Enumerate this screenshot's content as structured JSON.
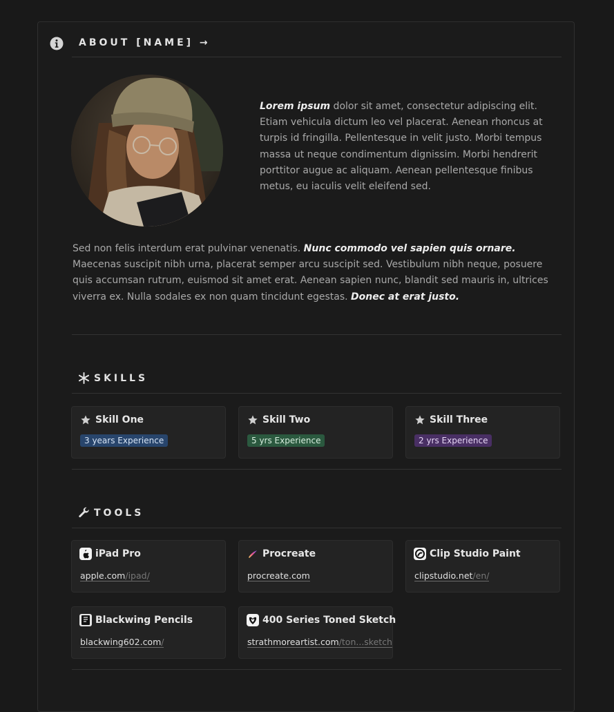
{
  "header": {
    "title": "ABOUT [NAME] →"
  },
  "about": {
    "intro_bold": "Lorem ipsum",
    "intro_text": " dolor sit amet, consectetur adipiscing elit. Etiam vehicula dictum leo vel placerat. Aenean rhoncus at turpis id fringilla. Pellentesque in velit justo. Morbi tempus massa ut neque condimentum dignissim. Morbi hendrerit porttitor augue ac aliquam. Aenean pellentesque finibus metus, eu iaculis velit eleifend sed.",
    "para_a": "Sed non felis interdum erat pulvinar venenatis. ",
    "para_b": "Nunc commodo vel sapien quis ornare.",
    "para_c": " Maecenas suscipit nibh urna, placerat semper arcu suscipit sed. Vestibulum nibh neque, posuere quis accumsan rutrum, euismod sit amet erat. Aenean sapien nunc, blandit sed mauris in, ultrices viverra ex. Nulla sodales ex non quam tincidunt egestas. ",
    "para_d": "Donec at erat justo."
  },
  "skills": {
    "heading": "SKILLS",
    "items": [
      {
        "name": "Skill One",
        "badge": "3 years Experience",
        "badge_bg": "#28456c",
        "badge_fg": "#d6e4f5"
      },
      {
        "name": "Skill Two",
        "badge": "5 yrs Experience",
        "badge_bg": "#2b593f",
        "badge_fg": "#d6eddd"
      },
      {
        "name": "Skill Three",
        "badge": "2 yrs Experience",
        "badge_bg": "#492f64",
        "badge_fg": "#e6d6f5"
      }
    ]
  },
  "tools": {
    "heading": "TOOLS",
    "items": [
      {
        "name": "iPad Pro",
        "link_main": "apple.com",
        "link_rest": "/ipad/",
        "icon": "apple-icon"
      },
      {
        "name": "Procreate",
        "link_main": "procreate.com",
        "link_rest": "",
        "icon": "procreate-icon"
      },
      {
        "name": "Clip Studio Paint",
        "link_main": "clipstudio.net",
        "link_rest": "/en/",
        "icon": "clip-studio-icon"
      },
      {
        "name": "Blackwing Pencils",
        "link_main": "blackwing602.com",
        "link_rest": "/",
        "icon": "blackwing-icon"
      },
      {
        "name": "400 Series Toned Sketch",
        "link_main": "strathmoreartist.com",
        "link_rest": "/ton...sketch",
        "icon": "strathmore-icon"
      }
    ]
  }
}
